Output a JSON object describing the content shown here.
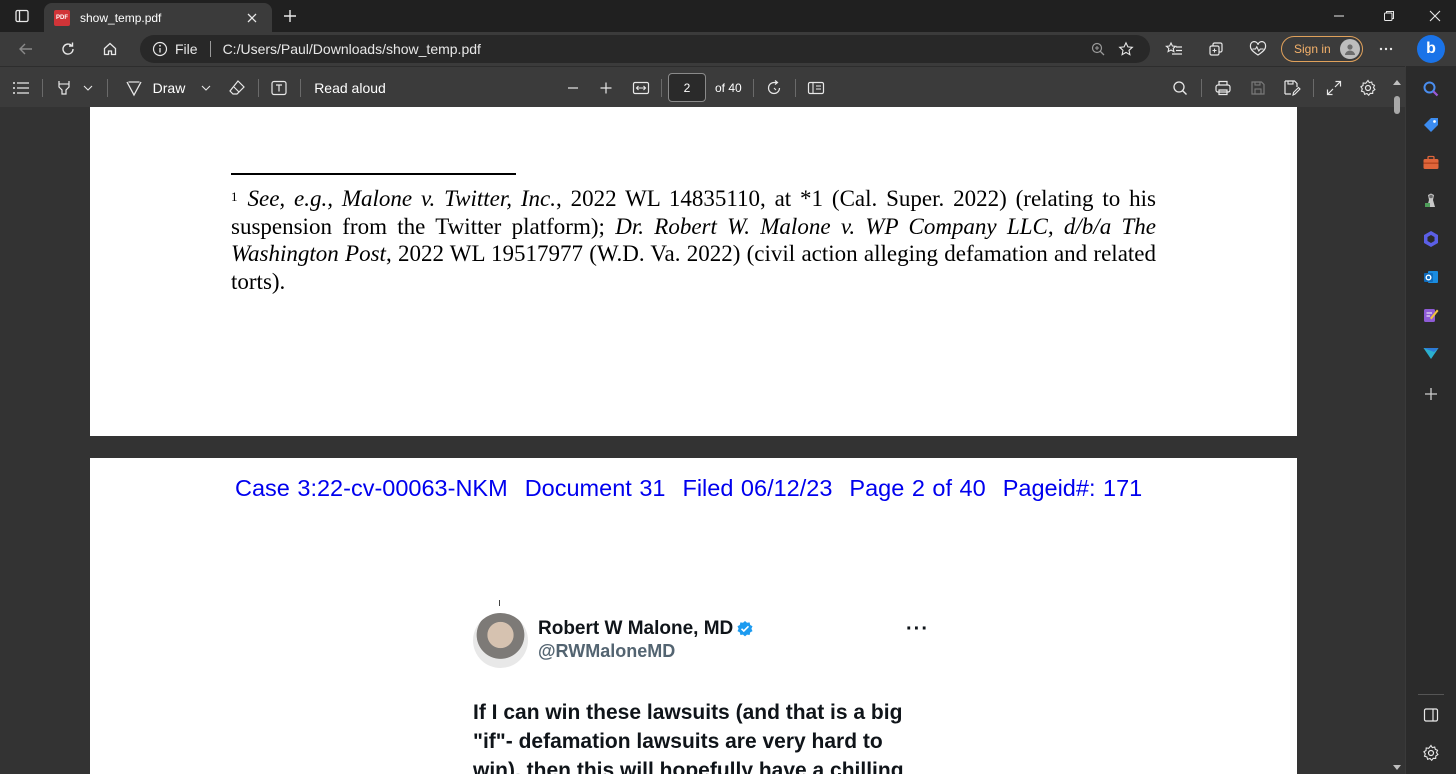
{
  "browser": {
    "tab": {
      "title": "show_temp.pdf",
      "favicon_text": "PDF"
    },
    "address": {
      "scheme_label": "File",
      "url": "C:/Users/Paul/Downloads/show_temp.pdf"
    },
    "sign_in_label": "Sign in",
    "copilot_letter": "b"
  },
  "pdf_toolbar": {
    "draw_label": "Draw",
    "read_aloud_label": "Read aloud",
    "current_page": "2",
    "page_count_label": "of 40"
  },
  "document": {
    "footnote": {
      "marker": "1",
      "see": "See",
      "eg": ", e.g., ",
      "case1": "Malone v. Twitter, Inc.",
      "text1": ", 2022 WL 14835110, at *1 (Cal. Super. 2022) (relating to his suspension from the Twitter platform); ",
      "case2": "Dr. Robert W. Malone v. WP Company LLC, d/b/a The Washington Post",
      "text2": ", 2022 WL 19517977 (W.D. Va. 2022) (civil action alleging defamation and related torts)."
    },
    "case_header": {
      "case": "Case 3:22-cv-00063-NKM",
      "document": "Document 31",
      "filed": "Filed 06/12/23",
      "page": "Page 2 of 40",
      "pageid": "Pageid#: 171"
    },
    "tweet": {
      "name": "Robert W Malone, MD",
      "handle": "@RWMaloneMD",
      "more": "···",
      "text": "If I can win these lawsuits (and that is a big \"if\"- defamation lawsuits are very hard to win), then this will hopefully have a chilling"
    }
  },
  "colors": {
    "case_header": "#0000ee",
    "signin_accent": "#f5b26b",
    "verified": "#1d9bf0"
  },
  "icons": {
    "sidebar": [
      "search-icon",
      "shopping-tag-icon",
      "toolbox-icon",
      "games-icon",
      "copilot-app-icon",
      "outlook-icon",
      "designer-icon",
      "drop-icon",
      "add-icon",
      "hide-sidebar-icon",
      "settings-icon"
    ]
  }
}
